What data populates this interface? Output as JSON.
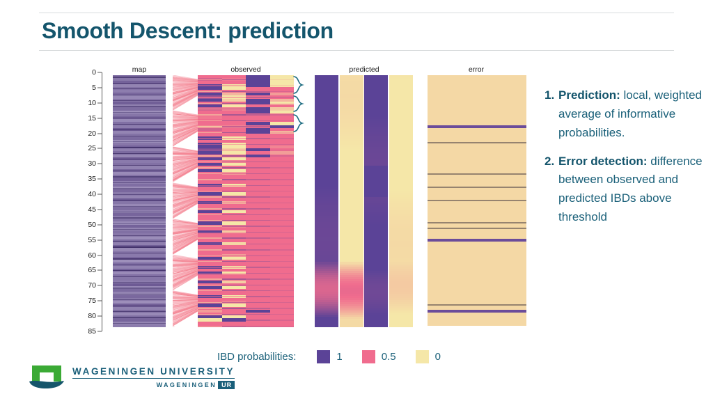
{
  "header": {
    "title": "Smooth Descent: prediction"
  },
  "figure": {
    "panels": [
      {
        "name": "map",
        "label": "map"
      },
      {
        "name": "observed",
        "label": "observed"
      },
      {
        "name": "predicted",
        "label": "predicted"
      },
      {
        "name": "error",
        "label": "error"
      }
    ],
    "y_axis": {
      "ticks": [
        0,
        5,
        10,
        15,
        20,
        25,
        30,
        35,
        40,
        45,
        50,
        55,
        60,
        65,
        70,
        75,
        80,
        85
      ],
      "min": 0,
      "max": 85
    },
    "brace_count": 3
  },
  "chart_data": {
    "type": "heatmap",
    "title": "",
    "xlabel": "",
    "ylabel": "",
    "ylim": [
      0,
      85
    ],
    "grid": false,
    "legend_position": "bottom",
    "colorscale": {
      "1": "#5B4397",
      "0.5": "#F06C8E",
      "0": "#F5E7A8"
    },
    "panels": [
      {
        "label": "map",
        "type": "stripes",
        "columns": 1,
        "description": "genetic map positions, horizontal bands of purple shades",
        "rows": [
          0.62,
          0.55,
          0.7,
          0.48,
          0.6,
          0.52,
          0.66,
          0.45,
          0.58,
          0.72,
          0.5,
          0.63,
          0.4,
          0.57,
          0.68,
          0.44,
          0.61,
          0.53,
          0.75,
          0.47,
          0.59,
          0.65,
          0.42,
          0.56,
          0.69,
          0.51,
          0.64,
          0.46,
          0.73,
          0.54,
          0.6,
          0.49,
          0.67,
          0.43,
          0.58,
          0.71,
          0.52,
          0.62,
          0.41,
          0.66,
          0.55,
          0.48,
          0.74,
          0.57,
          0.45,
          0.63,
          0.5,
          0.68,
          0.53,
          0.59,
          0.44,
          0.7,
          0.47,
          0.61,
          0.56,
          0.42,
          0.65,
          0.51,
          0.72,
          0.46,
          0.58,
          0.54,
          0.67,
          0.4,
          0.62,
          0.49,
          0.69,
          0.43,
          0.6,
          0.57,
          0.52,
          0.75,
          0.45,
          0.64,
          0.48,
          0.66,
          0.55,
          0.41,
          0.71,
          0.5,
          0.63,
          0.44,
          0.59,
          0.68,
          0.47,
          0.53
        ]
      },
      {
        "label": "observed",
        "type": "heatmap",
        "columns": 4,
        "description": "observed IBD probabilities per individual, 4 columns of banded purple/pink/yellow",
        "values": [
          [
            0.5,
            0.5,
            1.0,
            0.0
          ],
          [
            0.6,
            0.45,
            1.0,
            0.0
          ],
          [
            0.5,
            0.5,
            1.0,
            0.0
          ],
          [
            1.0,
            0.0,
            1.0,
            0.0
          ],
          [
            1.0,
            0.0,
            0.5,
            0.5
          ],
          [
            0.5,
            0.5,
            0.5,
            0.5
          ],
          [
            1.0,
            0.2,
            1.0,
            0.3
          ],
          [
            0.8,
            0.0,
            0.5,
            0.5
          ],
          [
            1.0,
            0.1,
            1.0,
            0.2
          ],
          [
            0.5,
            0.5,
            1.0,
            0.0
          ],
          [
            1.0,
            0.0,
            0.5,
            0.5
          ],
          [
            0.6,
            0.4,
            1.0,
            0.1
          ],
          [
            0.5,
            0.5,
            1.0,
            0.0
          ],
          [
            0.5,
            0.5,
            0.5,
            0.5
          ],
          [
            0.45,
            0.5,
            0.5,
            0.5
          ],
          [
            0.5,
            0.5,
            0.5,
            0.5
          ],
          [
            0.5,
            0.5,
            1.0,
            0.0
          ],
          [
            0.4,
            0.4,
            0.5,
            1.0
          ],
          [
            0.6,
            0.5,
            1.0,
            0.5
          ],
          [
            0.5,
            0.5,
            1.0,
            0.2
          ],
          [
            0.5,
            0.5,
            0.5,
            0.5
          ],
          [
            1.0,
            0.0,
            0.5,
            0.5
          ],
          [
            0.5,
            0.5,
            0.5,
            0.5
          ],
          [
            1.0,
            0.0,
            0.5,
            0.5
          ],
          [
            1.0,
            0.0,
            0.5,
            0.4
          ],
          [
            0.9,
            0.1,
            1.0,
            0.5
          ],
          [
            1.0,
            0.0,
            0.5,
            0.3
          ],
          [
            0.5,
            0.5,
            1.0,
            0.5
          ],
          [
            1.0,
            0.0,
            0.5,
            0.5
          ],
          [
            0.5,
            0.4,
            0.5,
            0.5
          ],
          [
            1.0,
            0.0,
            0.5,
            0.5
          ],
          [
            0.5,
            0.5,
            0.5,
            0.5
          ],
          [
            1.0,
            0.0,
            0.5,
            0.5
          ],
          [
            0.5,
            0.3,
            0.5,
            0.5
          ],
          [
            0.5,
            0.5,
            0.5,
            0.5
          ],
          [
            0.5,
            0.5,
            0.5,
            0.5
          ],
          [
            0.5,
            0.5,
            0.5,
            0.5
          ],
          [
            1.0,
            0.0,
            0.5,
            0.5
          ],
          [
            0.5,
            0.5,
            0.5,
            0.5
          ],
          [
            0.5,
            0.5,
            0.5,
            0.5
          ],
          [
            1.0,
            0.0,
            0.5,
            0.5
          ],
          [
            0.5,
            0.5,
            0.5,
            0.5
          ],
          [
            0.5,
            0.5,
            0.5,
            0.5
          ],
          [
            1.0,
            0.2,
            0.5,
            0.5
          ],
          [
            0.5,
            0.5,
            0.5,
            0.5
          ],
          [
            0.5,
            0.5,
            0.5,
            0.5
          ],
          [
            1.0,
            0.0,
            0.5,
            0.5
          ],
          [
            0.5,
            0.5,
            0.5,
            0.5
          ],
          [
            0.5,
            0.5,
            0.5,
            0.5
          ],
          [
            0.5,
            0.5,
            0.5,
            0.5
          ],
          [
            1.0,
            0.0,
            0.5,
            0.5
          ],
          [
            0.5,
            0.4,
            0.5,
            0.5
          ],
          [
            0.5,
            0.5,
            0.5,
            0.5
          ],
          [
            1.0,
            0.1,
            0.5,
            0.5
          ],
          [
            0.5,
            0.5,
            0.5,
            0.5
          ],
          [
            0.5,
            0.5,
            0.5,
            0.5
          ],
          [
            0.5,
            0.5,
            0.5,
            0.5
          ],
          [
            1.0,
            0.0,
            0.5,
            0.5
          ],
          [
            0.5,
            0.5,
            0.5,
            0.5
          ],
          [
            0.5,
            0.5,
            0.5,
            0.5
          ],
          [
            0.5,
            0.5,
            0.5,
            0.5
          ],
          [
            0.5,
            0.3,
            0.5,
            0.5
          ],
          [
            1.0,
            0.0,
            0.5,
            0.5
          ],
          [
            0.5,
            0.5,
            0.5,
            0.5
          ],
          [
            0.5,
            0.5,
            0.5,
            0.5
          ],
          [
            1.0,
            0.0,
            0.5,
            0.5
          ],
          [
            0.5,
            0.5,
            0.5,
            0.5
          ],
          [
            1.0,
            0.0,
            0.5,
            0.5
          ],
          [
            0.5,
            0.5,
            0.5,
            0.5
          ],
          [
            0.5,
            0.5,
            0.5,
            0.5
          ],
          [
            1.0,
            0.1,
            0.5,
            0.5
          ],
          [
            0.5,
            0.5,
            0.5,
            0.5
          ],
          [
            1.0,
            0.0,
            0.5,
            0.5
          ],
          [
            0.5,
            0.5,
            0.5,
            0.5
          ],
          [
            0.5,
            0.5,
            0.5,
            0.5
          ],
          [
            1.0,
            0.0,
            0.5,
            0.5
          ],
          [
            0.5,
            0.5,
            0.5,
            0.5
          ],
          [
            0.5,
            0.4,
            0.5,
            0.5
          ],
          [
            1.0,
            0.0,
            0.5,
            0.5
          ],
          [
            0.5,
            0.5,
            0.5,
            0.5
          ],
          [
            0.3,
            0.5,
            1.0,
            0.5
          ],
          [
            0.5,
            0.5,
            0.5,
            0.5
          ],
          [
            1.0,
            0.0,
            0.5,
            0.5
          ],
          [
            0.0,
            1.0,
            0.5,
            0.5
          ],
          [
            0.5,
            0.5,
            0.5,
            0.5
          ],
          [
            0.5,
            0.5,
            0.5,
            0.5
          ]
        ]
      },
      {
        "label": "predicted",
        "type": "heatmap",
        "columns": 4,
        "description": "smoothed predicted probabilities, 4 near-uniform columns purple/yellow/purple/yellow with pink gradients low down",
        "column_base": [
          1.0,
          0.0,
          1.0,
          0.0
        ]
      },
      {
        "label": "error",
        "type": "heatmap",
        "columns": 1,
        "description": "difference between observed and predicted, mostly zero (yellow) with purple lines where error exceeds threshold",
        "error_rows": [
          {
            "row": 17.5,
            "value": 1.0
          },
          {
            "row": 23.0,
            "value": 0.45
          },
          {
            "row": 33.5,
            "value": 0.7
          },
          {
            "row": 38.0,
            "value": 0.45
          },
          {
            "row": 42.5,
            "value": 0.45
          },
          {
            "row": 50.0,
            "value": 0.6
          },
          {
            "row": 52.0,
            "value": 0.55
          },
          {
            "row": 56.0,
            "value": 1.0
          },
          {
            "row": 78.0,
            "value": 0.5
          },
          {
            "row": 80.0,
            "value": 1.0
          }
        ]
      }
    ]
  },
  "bullets": [
    {
      "number": "1.",
      "lead": "Prediction:",
      "text": " local, weighted average of informative probabilities."
    },
    {
      "number": "2.",
      "lead": "Error detection:",
      "text": " difference between observed and predicted IBDs above threshold"
    }
  ],
  "legend": {
    "title": "IBD probabilities:",
    "items": [
      {
        "label": "1",
        "color": "#5B4397"
      },
      {
        "label": "0.5",
        "color": "#F06C8E"
      },
      {
        "label": "0",
        "color": "#F5E7A8"
      }
    ]
  },
  "logo": {
    "line1": "WAGENINGEN UNIVERSITY",
    "line2": "WAGENINGEN",
    "badge": "UR"
  }
}
